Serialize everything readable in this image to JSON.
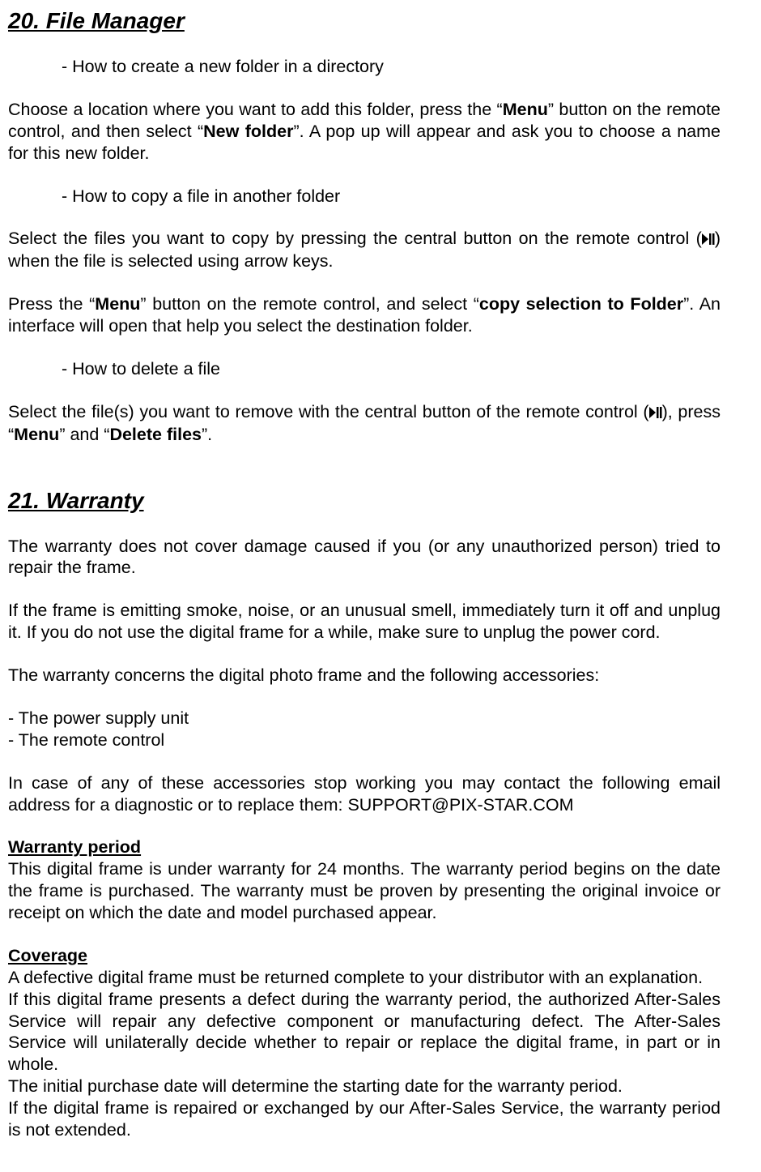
{
  "s20": {
    "title": "20. File Manager",
    "sub1": "- How to create a new folder in a directory",
    "p1_pre": "Choose a location where you want to add this folder, press the “",
    "p1_menu": "Menu",
    "p1_mid": "” button on the remote control, and then select “",
    "p1_newfolder": "New folder",
    "p1_post": "”. A pop up will appear and ask you to choose a name for this new folder.",
    "sub2": "- How to copy a file in another folder",
    "p2_pre": "Select the files you want to copy by pressing the central button on the remote control (",
    "p2_post": ") when the file is selected using arrow keys.",
    "p3_pre": "Press the “",
    "p3_menu": "Menu",
    "p3_mid": "” button on the remote control, and select “",
    "p3_copy": "copy selection to Folder",
    "p3_post": "”. An interface will open that help you select the destination folder.",
    "sub3": "- How to delete a file",
    "p4_pre": "Select the file(s) you want to remove with the central button of the remote control (",
    "p4_mid": "), press “",
    "p4_menu": "Menu",
    "p4_and": "” and “",
    "p4_delete": "Delete files",
    "p4_post": "”."
  },
  "s21": {
    "title": "21. Warranty",
    "p1": "The warranty does not cover damage caused if you (or any unauthorized person) tried to repair the frame.",
    "p2": "If the frame is emitting smoke, noise, or an unusual smell, immediately turn it off and unplug it. If you do not use the digital frame for a while, make sure to unplug the power cord.",
    "p3": "The warranty concerns the digital photo frame and the following accessories:",
    "acc1": "- The power supply unit",
    "acc2": "- The remote control",
    "p4": "In case of any of these accessories stop working you may contact the following email address for a diagnostic or to replace them: SUPPORT@PIX-STAR.COM",
    "h_wp": "Warranty period",
    "wp": "This digital frame is under warranty for 24 months. The warranty period begins on the date the frame is purchased. The warranty must be proven by presenting the original invoice or receipt on which the date and model purchased appear.",
    "h_cov": "Coverage",
    "cov1": "A defective digital frame must be returned complete to your distributor with an explanation.",
    "cov2": "If this digital frame presents a defect during the warranty period, the authorized After-Sales Service will repair any defective component or manufacturing defect. The After-Sales Service will unilaterally decide whether to repair or replace the digital frame, in part or in whole.",
    "cov3": "The initial purchase date will determine the starting date for the warranty period.",
    "cov4": "If the digital frame is repaired or exchanged by our After-Sales Service, the warranty period is not extended."
  }
}
